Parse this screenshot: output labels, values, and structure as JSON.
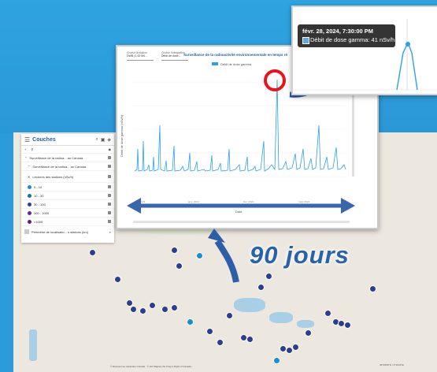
{
  "layers_panel": {
    "title": "Couches",
    "items": [
      {
        "label": "Surveillance de la radioa... au Canada"
      },
      {
        "label": "Surveillance de la radioa... au Canada"
      },
      {
        "label": "Lectures des stations (nSv/h)"
      },
      {
        "label": "0 - 10",
        "color": "#1a8fd0"
      },
      {
        "label": "10 - 30",
        "color": "#1e6fb0"
      },
      {
        "label": "30 - 100",
        "color": "#2e3e8f"
      },
      {
        "label": "100 - 1000",
        "color": "#5a2d8a"
      },
      {
        "label": ">1000",
        "color": "#6a1b7a"
      },
      {
        "label": "Périmètre de localisatio... s stations (km)"
      }
    ]
  },
  "chart": {
    "control1_label": "Choisir la station",
    "control1_value": "DWB (1.43 M4...",
    "control2_label": "Choisir l'intégration",
    "control2_value": "Débit de dose...",
    "title": "Surveillance de la radioactivité environnementale en temps ré",
    "legend": "Débit de dose gamma",
    "ylabel": "Débit de dose gamma (nSv/h)",
    "xlabel": "Date",
    "bar_color": "#2aa0e8"
  },
  "tooltip": {
    "timestamp": "févr. 28, 2024, 7:30:00 PM",
    "value_text": "Débit de dose gamma: 41 nSv/h"
  },
  "annotation": {
    "days_label": "90 jours"
  },
  "map": {
    "attribution": "© Ressources naturelles Canada · © His Majesty the King in Right of Canada...",
    "coords": "45°28'06\"N / 4°36'20\"E"
  }
}
